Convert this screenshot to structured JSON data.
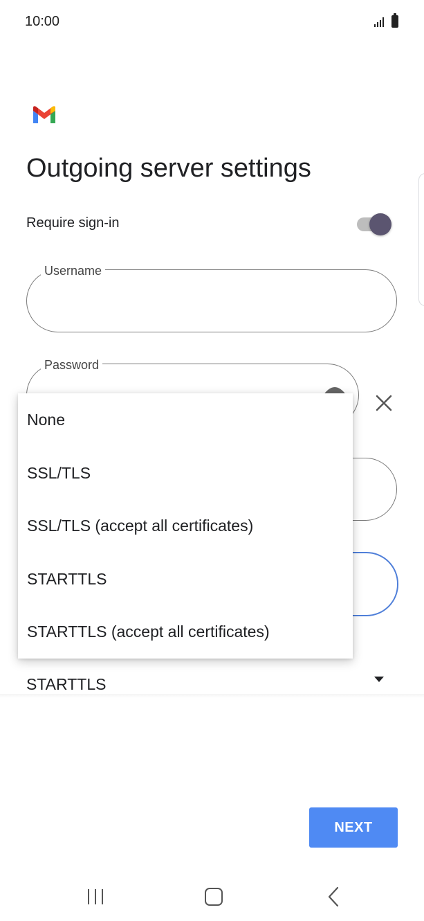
{
  "status_bar": {
    "time": "10:00",
    "signal_icon": "signal-icon",
    "battery_icon": "battery-icon"
  },
  "app": {
    "logo_icon": "gmail-logo-icon",
    "brand_colors": [
      "#4285F4",
      "#EA4335",
      "#FBBC05",
      "#34A853"
    ]
  },
  "page": {
    "title": "Outgoing server settings"
  },
  "require_signin": {
    "label": "Require sign-in",
    "enabled": true
  },
  "username": {
    "label": "Username",
    "value": ""
  },
  "password": {
    "label": "Password",
    "value": ""
  },
  "security": {
    "selected": "STARTTLS",
    "options": [
      "None",
      "SSL/TLS",
      "SSL/TLS (accept all certificates)",
      "STARTTLS",
      "STARTTLS (accept all certificates)"
    ]
  },
  "actions": {
    "next_label": "NEXT"
  },
  "colors": {
    "accent": "#4f8af3",
    "focus_border": "#4f7fd9",
    "toggle_thumb": "#5b5570"
  }
}
